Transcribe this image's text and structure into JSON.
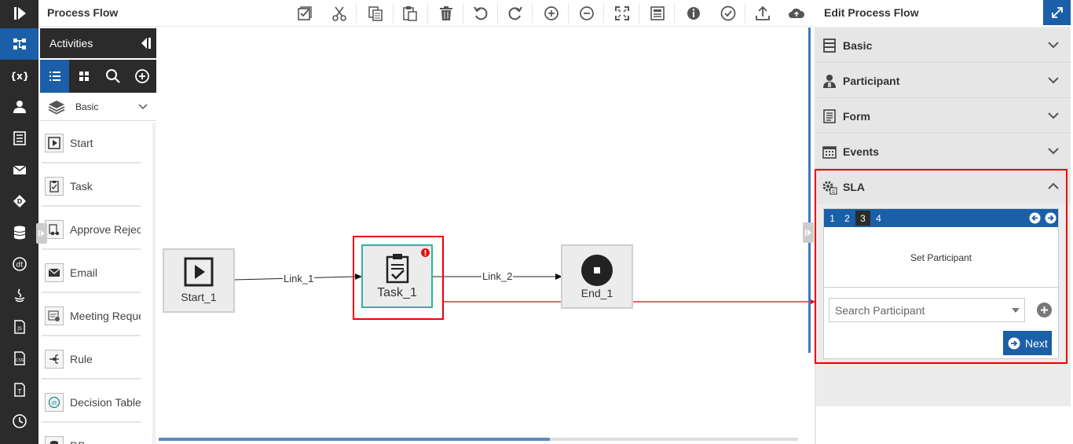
{
  "app": {
    "page_title": "Process Flow"
  },
  "left_rail": {
    "items": [
      "logo-icon",
      "process-flow-icon",
      "variables-icon",
      "participant-icon",
      "form-icon",
      "email-icon",
      "decision-icon",
      "database-icon",
      "decision-table-icon",
      "java-icon",
      "js-file-icon",
      "css-file-icon",
      "text-icon",
      "history-icon"
    ]
  },
  "activities": {
    "header": "Activities",
    "category": "Basic",
    "items": [
      {
        "label": "Start",
        "icon": "play-icon"
      },
      {
        "label": "Task",
        "icon": "clipboard-icon"
      },
      {
        "label": "Approve Reject",
        "icon": "approve-reject-icon"
      },
      {
        "label": "Email",
        "icon": "email-icon"
      },
      {
        "label": "Meeting Request",
        "icon": "meeting-icon"
      },
      {
        "label": "Rule",
        "icon": "rule-icon"
      },
      {
        "label": "Decision Table",
        "icon": "decision-table-icon"
      },
      {
        "label": "DB",
        "icon": "database-icon"
      }
    ]
  },
  "toolbar": {
    "buttons": [
      "select-all",
      "cut",
      "copy",
      "paste",
      "delete",
      "undo",
      "redo",
      "zoom-in",
      "zoom-out",
      "fit-screen",
      "properties",
      "info",
      "validate",
      "upload",
      "cloud-upload"
    ]
  },
  "canvas": {
    "nodes": {
      "start": "Start_1",
      "task": "Task_1",
      "end": "End_1"
    },
    "links": {
      "link1": "Link_1",
      "link2": "Link_2"
    },
    "colors": {
      "task_border": "#2db3a5",
      "error": "#d11",
      "highlight": "#e00"
    }
  },
  "right_panel": {
    "title": "Edit Process Flow",
    "sections": [
      "Basic",
      "Participant",
      "Form",
      "Events",
      "SLA"
    ],
    "sla": {
      "steps": [
        "1",
        "2",
        "3",
        "4"
      ],
      "active_step": "3",
      "step_title": "Set Participant",
      "search_placeholder": "Search Participant",
      "next_label": "Next"
    }
  }
}
